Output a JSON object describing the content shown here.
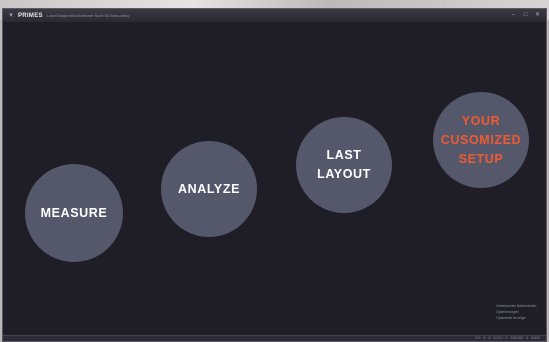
{
  "window": {
    "brand": "PRIMES",
    "path": "LaserDiagnosticsSoftware Scott 06 Beta.pdfsq",
    "controls": [
      "–",
      "□",
      "✕"
    ]
  },
  "workflow_steps": [
    {
      "label": "MEASURE",
      "color": "#ffffff"
    },
    {
      "label": "ANALYZE",
      "color": "#ffffff"
    },
    {
      "label": "LAST\nLAYOUT",
      "color": "#ffffff"
    },
    {
      "label": "YOUR\nCUSOMIZED\nSETUP",
      "color": "#ef5a32"
    }
  ],
  "side_menu": {
    "items": [
      "Unbekannter Bedienfehler",
      "Optimierungen",
      "Optimierte Anzeige"
    ]
  },
  "status_bar": {
    "text": "0:0 · 0 · 0 · 10:01 · 0 · 100/100 · 0 · 0/400"
  },
  "colors": {
    "window_bg": "#1f1e27",
    "circle_fill": "#55586b",
    "accent": "#ef5a32"
  }
}
